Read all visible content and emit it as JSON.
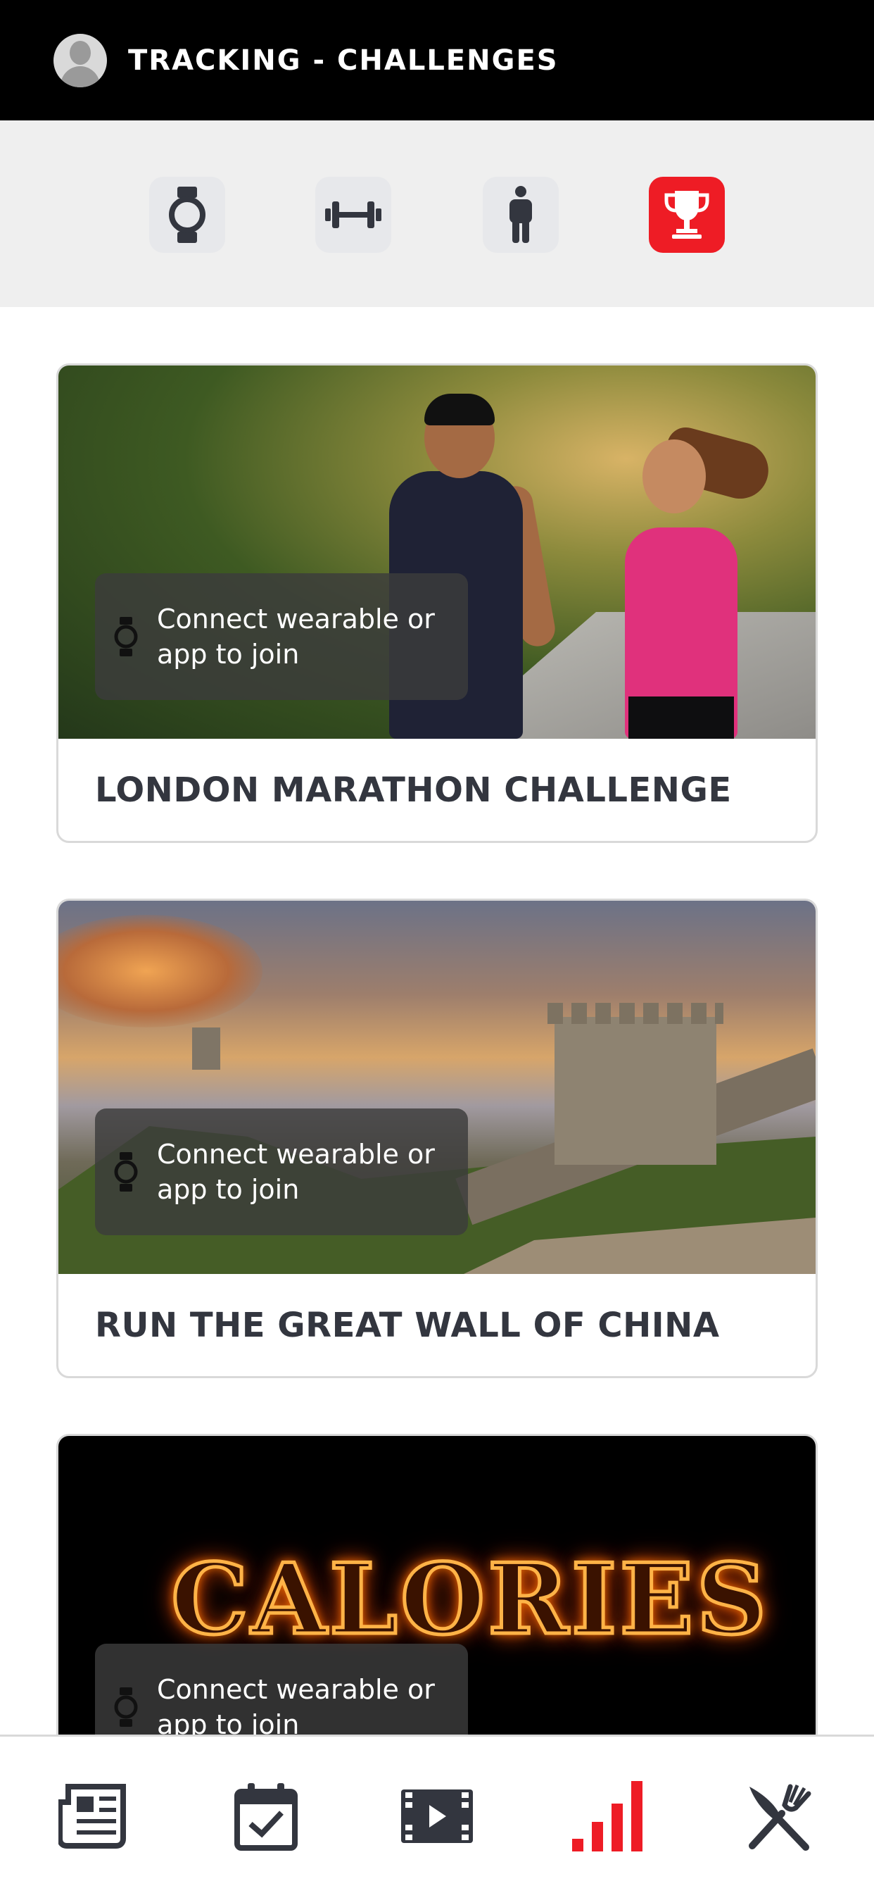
{
  "header": {
    "title": "TRACKING - CHALLENGES"
  },
  "tracking_tabs": [
    {
      "name": "wearable",
      "icon": "watch-icon",
      "active": false
    },
    {
      "name": "workouts",
      "icon": "dumbbell-icon",
      "active": false
    },
    {
      "name": "body",
      "icon": "person-icon",
      "active": false
    },
    {
      "name": "challenges",
      "icon": "trophy-icon",
      "active": true
    }
  ],
  "challenges": [
    {
      "title": "LONDON MARATHON CHALLENGE",
      "connect_text": "Connect wearable or app to join",
      "image": "runners-photo"
    },
    {
      "title": "RUN THE GREAT WALL OF CHINA",
      "connect_text": "Connect wearable or app to join",
      "image": "great-wall-photo"
    },
    {
      "title": "",
      "connect_text": "Connect wearable or app to join",
      "image": "calories-fire-photo",
      "image_text": "CALORIES"
    }
  ],
  "bottom_nav": [
    {
      "name": "news",
      "icon": "newspaper-icon",
      "active": false
    },
    {
      "name": "schedule",
      "icon": "calendar-check-icon",
      "active": false
    },
    {
      "name": "videos",
      "icon": "video-icon",
      "active": false
    },
    {
      "name": "tracking",
      "icon": "bar-chart-icon",
      "active": true
    },
    {
      "name": "nutrition",
      "icon": "fork-knife-icon",
      "active": false
    }
  ],
  "colors": {
    "accent": "#ee1c25",
    "icon_dark": "#33363f",
    "header_bg": "#000000",
    "tab_strip_bg": "#efefef"
  }
}
